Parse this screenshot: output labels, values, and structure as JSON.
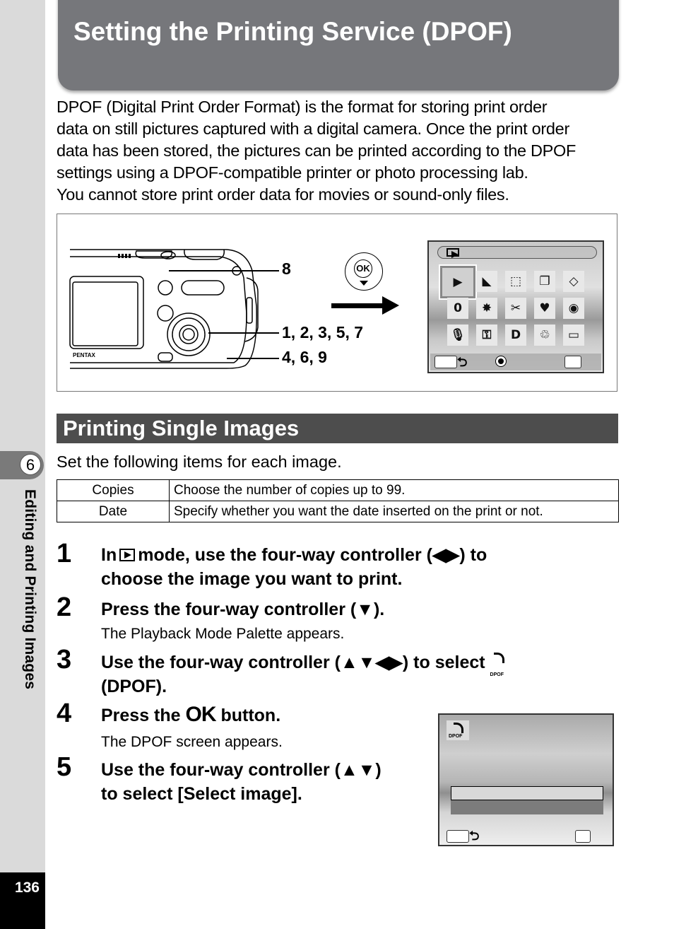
{
  "header": {
    "title": "Setting the Printing Service (DPOF)"
  },
  "intro": {
    "lines": [
      "DPOF (Digital Print Order Format) is the format for storing print order",
      "data on still pictures captured with a digital camera. Once the print order",
      "data has been stored, the pictures can be printed according to the DPOF",
      "settings using a DPOF-compatible printer or photo processing lab.",
      "You cannot store print order data for movies or sound-only files."
    ]
  },
  "figure": {
    "camera_brand": "PENTAX",
    "callouts": [
      "8",
      "1, 2, 3, 5, 7",
      "4, 6, 9"
    ],
    "ok_label": "OK",
    "palette_icons": [
      "playback-slideshow-icon",
      "resize-icon",
      "trimming-icon",
      "image-copy-icon",
      "rotate-icon",
      "digital-filter-icon",
      "brightness-filter-icon",
      "movie-edit-icon",
      "frame-composite-icon",
      "red-eye-edit-icon",
      "voice-memo-icon",
      "protect-icon",
      "dpof-icon",
      "recovery-icon",
      "start-up-screen-icon"
    ],
    "dpof_label": "DPOF"
  },
  "section": {
    "title": "Printing Single Images",
    "lead": "Set the following items for each image.",
    "table": [
      {
        "item": "Copies",
        "desc": "Choose the number of copies up to 99."
      },
      {
        "item": "Date",
        "desc": "Specify whether you want the date inserted on the print or not."
      }
    ]
  },
  "steps": [
    {
      "num": "1",
      "pre": "In",
      "post": "mode, use the four-way controller (◀▶) to",
      "line2": "choose the image you want to print."
    },
    {
      "num": "2",
      "text": "Press the four-way controller (▼).",
      "sub": "The Playback Mode Palette appears."
    },
    {
      "num": "3",
      "text": "Use the four-way controller (▲▼◀▶) to select",
      "line2": "(DPOF)."
    },
    {
      "num": "4",
      "pre": "Press the",
      "ok": "OK",
      "post": "button.",
      "sub": "The DPOF screen appears."
    },
    {
      "num": "5",
      "text": "Use the four-way controller (▲▼)",
      "line2": "to select [Select image]."
    }
  ],
  "sidebar": {
    "chapter_number": "6",
    "chapter_title": "Editing and Printing Images",
    "page_number": "136"
  }
}
